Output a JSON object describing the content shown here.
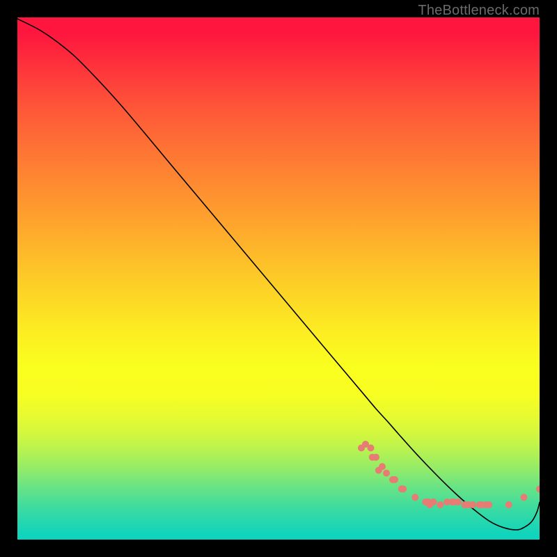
{
  "watermark": "TheBottleneck.com",
  "chart_data": {
    "type": "line",
    "title": "",
    "xlabel": "",
    "ylabel": "",
    "xlim": [
      0,
      100
    ],
    "ylim": [
      0,
      100
    ],
    "grid": false,
    "legend": false,
    "curve": {
      "x": [
        0,
        4.5,
        9,
        13,
        20,
        30,
        40,
        50,
        60,
        66,
        68.7,
        71,
        73,
        76.5,
        80,
        83.5,
        87,
        90.5,
        93,
        95.5,
        97,
        98.5,
        99.5,
        100
      ],
      "y": [
        100,
        98,
        95.2,
        92,
        85.4,
        75,
        64.6,
        54.2,
        43.8,
        37.6,
        34.8,
        32.6,
        30.6,
        27.2,
        24,
        21,
        18.3,
        16,
        15,
        14.6,
        15,
        16,
        17.6,
        19.2
      ]
    },
    "scatter": {
      "x": [
        65.9,
        66.7,
        67.7,
        68.0,
        68.7,
        69.2,
        69.9,
        70.7,
        71.9,
        72.3,
        73.6,
        73.9,
        76.2,
        78.2,
        78.7,
        78.7,
        79.0,
        79.7,
        81.0,
        82.3,
        83.3,
        83.6,
        84.4,
        85.7,
        86.4,
        87.2,
        88.5,
        89.0,
        89.8,
        90.3,
        94.1,
        97.0,
        100.0
      ],
      "y": [
        24.2,
        24.6,
        24.2,
        23.2,
        23.2,
        21.8,
        22.2,
        21.5,
        20.8,
        20.8,
        19.8,
        19.8,
        18.9,
        18.4,
        18.4,
        18.4,
        18.1,
        18.4,
        18.1,
        18.4,
        18.4,
        18.4,
        18.4,
        18.1,
        18.1,
        18.1,
        18.1,
        18.1,
        18.1,
        18.1,
        18.1,
        18.9,
        19.8
      ],
      "color": "#e67c73",
      "radius_px": 5
    }
  }
}
